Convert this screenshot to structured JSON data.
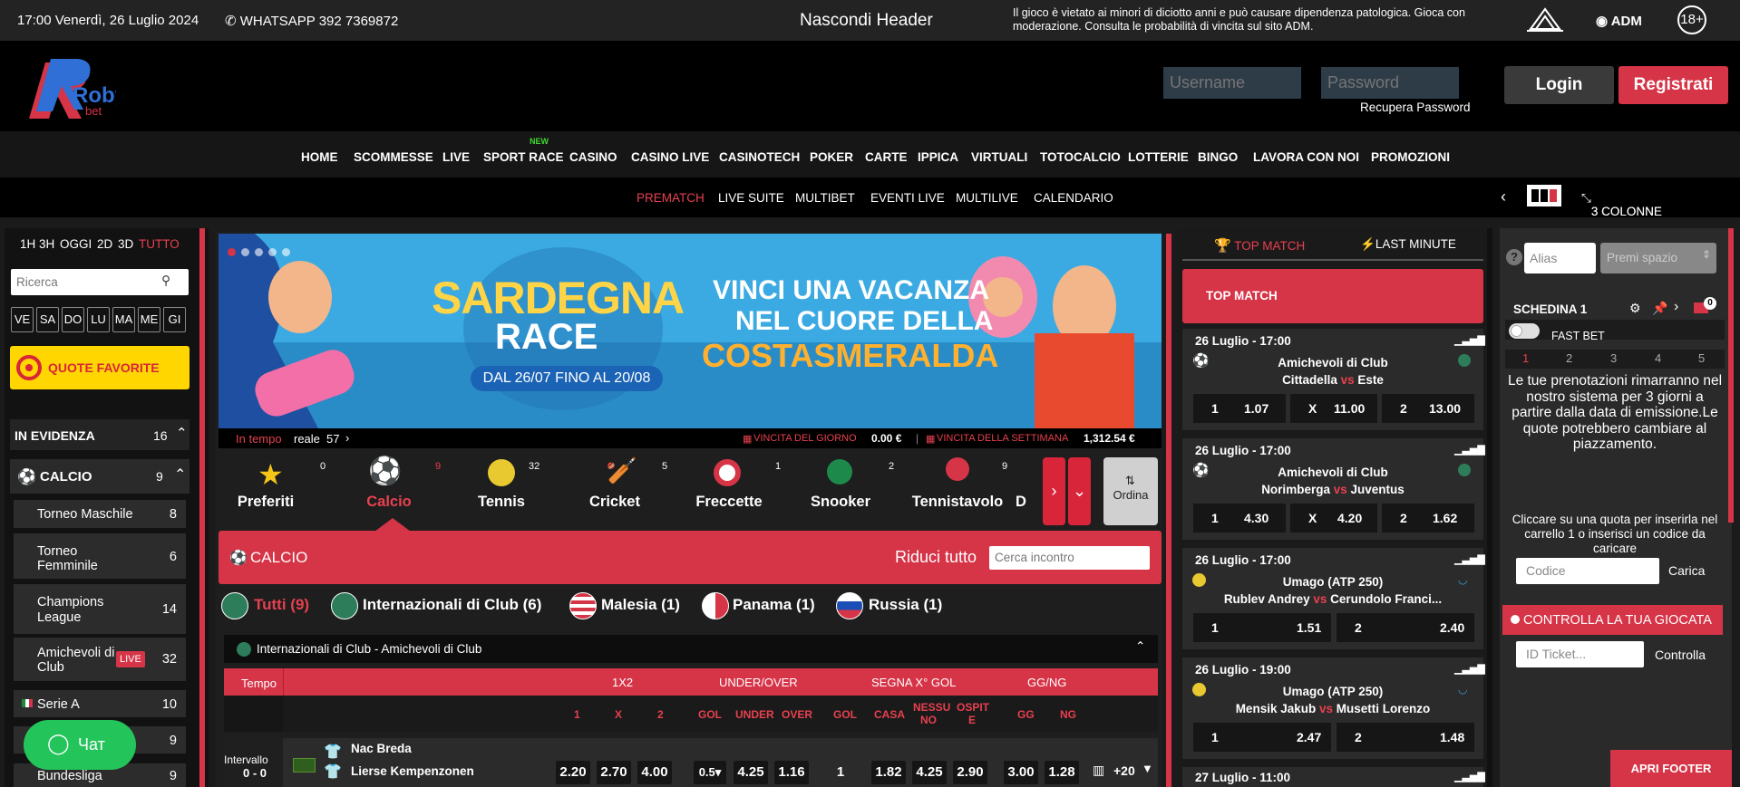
{
  "topbar": {
    "datetime": "17:00 Venerdì, 26 Luglio 2024",
    "whatsapp": "WHATSAPP 392 7369872",
    "hide_header": "Nascondi Header",
    "warning": "Il gioco è vietato ai minori di diciotto anni e può causare dipendenza patologica. Gioca con moderazione. Consulta le probabilità di vincita sul sito ADM.",
    "adm": "ADM",
    "age": "18+"
  },
  "header": {
    "logo_text": "Roby",
    "logo_sub": "bet",
    "username_placeholder": "Username",
    "password_placeholder": "Password",
    "recover": "Recupera Password",
    "login": "Login",
    "register": "Registrati"
  },
  "nav": {
    "items": [
      "HOME",
      "SCOMMESSE",
      "LIVE",
      "SPORT RACE",
      "CASINO",
      "CASINO LIVE",
      "CASINOTECH",
      "POKER",
      "CARTE",
      "IPPICA",
      "VIRTUALI",
      "TOTOCALCIO",
      "LOTTERIE",
      "BINGO",
      "LAVORA CON NOI",
      "PROMOZIONI"
    ],
    "new_badge": "NEW"
  },
  "subnav": {
    "items": [
      "PREMATCH",
      "LIVE SUITE",
      "MULTIBET",
      "EVENTI LIVE",
      "MULTILIVE",
      "CALENDARIO"
    ],
    "columns": "3 COLONNE"
  },
  "left": {
    "periods": [
      "1H",
      "3H",
      "OGGI",
      "2D",
      "3D",
      "TUTTO"
    ],
    "search_placeholder": "Ricerca",
    "days": [
      "VE",
      "SA",
      "DO",
      "LU",
      "MA",
      "ME",
      "GI"
    ],
    "favorites": "QUOTE FAVORITE",
    "evidence": "IN EVIDENZA",
    "evidence_count": "16",
    "calcio": "CALCIO",
    "calcio_count": "9",
    "leagues": [
      {
        "name": "Torneo Maschile",
        "count": "8"
      },
      {
        "name": "Torneo Femminile",
        "count": "6"
      },
      {
        "name": "Champions League",
        "count": "14"
      },
      {
        "name": "Amichevoli di Club",
        "count": "32",
        "badge": "LIVE"
      },
      {
        "name": "Serie A",
        "count": "10"
      },
      {
        "name": "",
        "count": "9"
      },
      {
        "name": "Bundesliga",
        "count": "9"
      }
    ],
    "chat": "Чат"
  },
  "banner": {
    "title1": "SARDEGNA",
    "title2": "RACE",
    "dates": "DAL 26/07 FINO AL 20/08",
    "line1": "VINCI UNA VACANZA",
    "line2": "NEL CUORE DELLA",
    "line3": "COSTASMERALDA",
    "intime": "In tempo",
    "real": "reale",
    "real_num": "57",
    "vday": "VINCITA DEL GIORNO",
    "vday_val": "0.00 €",
    "vweek": "VINCITA DELLA SETTIMANA",
    "vweek_val": "1,312.54 €"
  },
  "sports": [
    {
      "name": "Preferiti",
      "count": "0"
    },
    {
      "name": "Calcio",
      "count": "9"
    },
    {
      "name": "Tennis",
      "count": "32"
    },
    {
      "name": "Cricket",
      "count": "5"
    },
    {
      "name": "Freccette",
      "count": "1"
    },
    {
      "name": "Snooker",
      "count": "2"
    },
    {
      "name": "Tennistavolo",
      "count": "9"
    },
    {
      "name": "D",
      "count": ""
    }
  ],
  "order": "Ordina",
  "calcio_bar": {
    "title": "CALCIO",
    "collapse": "Riduci tutto",
    "search": "Cerca incontro"
  },
  "filters": [
    {
      "name": "Tutti",
      "count": "(9)"
    },
    {
      "name": "Internazionali di Club",
      "count": "(6)"
    },
    {
      "name": "Malesia",
      "count": "(1)"
    },
    {
      "name": "Panama",
      "count": "(1)"
    },
    {
      "name": "Russia",
      "count": "(1)"
    }
  ],
  "league_bar": "Internazionali di Club - Amichevoli di Club",
  "table": {
    "tempo": "Tempo",
    "groups": [
      "1X2",
      "UNDER/OVER",
      "SEGNA X° GOL",
      "GG/NG"
    ],
    "cols": [
      "1",
      "X",
      "2",
      "GOL",
      "UNDER",
      "OVER",
      "GOL",
      "CASA",
      "NESSU NO",
      "OSPIT E",
      "GG",
      "NG"
    ]
  },
  "match": {
    "status": "Intervallo",
    "score": "0 - 0",
    "home": "Nac Breda",
    "away": "Lierse Kempenzonen",
    "odds": [
      "2.20",
      "2.70",
      "4.00",
      "0.5",
      "4.25",
      "1.16",
      "1",
      "1.82",
      "4.25",
      "2.90",
      "3.00",
      "1.28"
    ],
    "more": "+20"
  },
  "right": {
    "tab_top": "TOP MATCH",
    "tab_last": "LAST MINUTE",
    "header": "TOP MATCH",
    "vs": "vs",
    "cards": [
      {
        "date": "26 Luglio - 17:00",
        "league": "Amichevoli di Club",
        "home": "Cittadella",
        "away": "Este",
        "l1": "1",
        "o1": "1.07",
        "l2": "X",
        "o2": "11.00",
        "l3": "2",
        "o3": "13.00"
      },
      {
        "date": "26 Luglio - 17:00",
        "league": "Amichevoli di Club",
        "home": "Norimberga",
        "away": "Juventus",
        "l1": "1",
        "o1": "4.30",
        "l2": "X",
        "o2": "4.20",
        "l3": "2",
        "o3": "1.62"
      },
      {
        "date": "26 Luglio - 17:00",
        "league": "Umago (ATP 250)",
        "home": "Rublev Andrey",
        "away": "Cerundolo Franci...",
        "l1": "1",
        "o1": "1.51",
        "l2": "2",
        "o2": "2.40"
      },
      {
        "date": "26 Luglio - 19:00",
        "league": "Umago (ATP 250)",
        "home": "Mensik Jakub",
        "away": "Musetti Lorenzo",
        "l1": "1",
        "o1": "2.47",
        "l2": "2",
        "o2": "1.48"
      },
      {
        "date": "27 Luglio - 11:00"
      }
    ]
  },
  "slip": {
    "alias": "Alias",
    "premi": "Premi spazio",
    "title": "SCHEDINA 1",
    "badge": "0",
    "fast": "FAST BET",
    "tabs": [
      "1",
      "2",
      "3",
      "4",
      "5"
    ],
    "note1": "Le tue prenotazioni rimarranno nel nostro sistema per 3 giorni a partire dalla data di emissione.Le quote potrebbero cambiare al piazzamento.",
    "note2": "Cliccare su una quota per inserirla nel carrello 1 o inserisci un codice da caricare",
    "code": "Codice",
    "load": "Carica",
    "control_title": "CONTROLLA LA TUA GIOCATA",
    "ticket": "ID Ticket...",
    "check": "Controlla",
    "footer": "APRI FOOTER"
  }
}
